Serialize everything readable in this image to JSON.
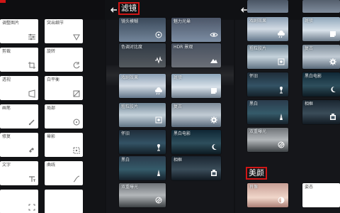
{
  "panels": {
    "left": {
      "cards": [
        {
          "label": "调整图片"
        },
        {
          "label": "突出细节"
        },
        {
          "label": "剪裁"
        },
        {
          "label": "旋转"
        },
        {
          "label": "透视"
        },
        {
          "label": "白平衡"
        },
        {
          "label": "画笔"
        },
        {
          "label": "局部"
        },
        {
          "label": "修复"
        },
        {
          "label": "晕影"
        },
        {
          "label": "文字"
        },
        {
          "label": "曲线"
        },
        {
          "label": ""
        },
        {
          "label": ""
        }
      ]
    },
    "middle": {
      "title": "滤镜",
      "cards": [
        {
          "label": "镜头模糊",
          "icon": "focus-icon"
        },
        {
          "label": "魅力光晕",
          "icon": "eye-icon"
        },
        {
          "label": "色调对比度",
          "icon": "waveform-icon"
        },
        {
          "label": "HDR 景观",
          "icon": "mountain-icon"
        },
        {
          "label": "戏剧效果",
          "icon": "cloud-icon"
        },
        {
          "label": "斑驳",
          "icon": "sticker-icon"
        },
        {
          "label": "粗粒胶片",
          "icon": "film-icon"
        },
        {
          "label": "复古",
          "icon": "settings-icon"
        },
        {
          "label": "怀旧",
          "icon": "lamp-icon"
        },
        {
          "label": "黑白电影",
          "icon": "moon-icon"
        },
        {
          "label": "黑白",
          "icon": "tower-icon"
        },
        {
          "label": "相框",
          "icon": "frame-icon"
        },
        {
          "label": "双重曝光",
          "icon": "double-exposure-icon"
        }
      ]
    },
    "right": {
      "beauty_title": "美颜",
      "cards": [
        {
          "label": "",
          "icon": "none"
        },
        {
          "label": "",
          "icon": "none"
        },
        {
          "label": "戏剧效果",
          "icon": "cloud-icon"
        },
        {
          "label": "斑驳",
          "icon": "sticker-icon"
        },
        {
          "label": "粗粒胶片",
          "icon": "film-icon"
        },
        {
          "label": "复古",
          "icon": "settings-icon"
        },
        {
          "label": "怀旧",
          "icon": "lamp-icon"
        },
        {
          "label": "黑白电影",
          "icon": "moon-icon"
        },
        {
          "label": "黑白",
          "icon": "tower-icon"
        },
        {
          "label": "相框",
          "icon": "frame-icon"
        },
        {
          "label": "双重曝光",
          "icon": "double-exposure-icon"
        },
        {
          "label": "肖像",
          "icon": "face-icon"
        },
        {
          "label": "姿态",
          "icon": "none"
        }
      ]
    }
  }
}
